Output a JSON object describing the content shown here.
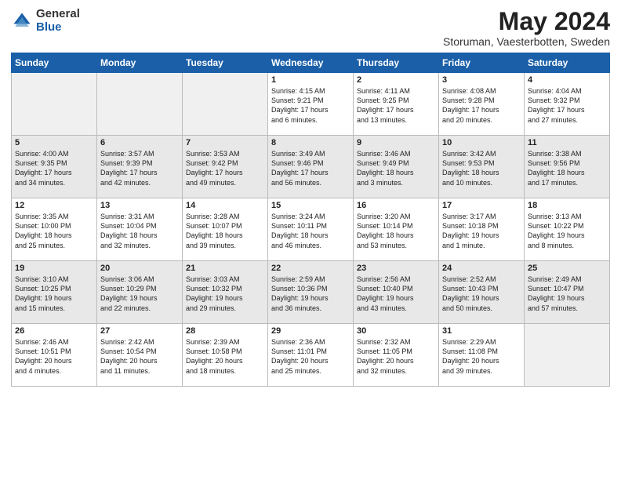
{
  "header": {
    "logo_general": "General",
    "logo_blue": "Blue",
    "title": "May 2024",
    "location": "Storuman, Vaesterbotten, Sweden"
  },
  "weekdays": [
    "Sunday",
    "Monday",
    "Tuesday",
    "Wednesday",
    "Thursday",
    "Friday",
    "Saturday"
  ],
  "weeks": [
    [
      {
        "day": "",
        "info": ""
      },
      {
        "day": "",
        "info": ""
      },
      {
        "day": "",
        "info": ""
      },
      {
        "day": "1",
        "info": "Sunrise: 4:15 AM\nSunset: 9:21 PM\nDaylight: 17 hours\nand 6 minutes."
      },
      {
        "day": "2",
        "info": "Sunrise: 4:11 AM\nSunset: 9:25 PM\nDaylight: 17 hours\nand 13 minutes."
      },
      {
        "day": "3",
        "info": "Sunrise: 4:08 AM\nSunset: 9:28 PM\nDaylight: 17 hours\nand 20 minutes."
      },
      {
        "day": "4",
        "info": "Sunrise: 4:04 AM\nSunset: 9:32 PM\nDaylight: 17 hours\nand 27 minutes."
      }
    ],
    [
      {
        "day": "5",
        "info": "Sunrise: 4:00 AM\nSunset: 9:35 PM\nDaylight: 17 hours\nand 34 minutes."
      },
      {
        "day": "6",
        "info": "Sunrise: 3:57 AM\nSunset: 9:39 PM\nDaylight: 17 hours\nand 42 minutes."
      },
      {
        "day": "7",
        "info": "Sunrise: 3:53 AM\nSunset: 9:42 PM\nDaylight: 17 hours\nand 49 minutes."
      },
      {
        "day": "8",
        "info": "Sunrise: 3:49 AM\nSunset: 9:46 PM\nDaylight: 17 hours\nand 56 minutes."
      },
      {
        "day": "9",
        "info": "Sunrise: 3:46 AM\nSunset: 9:49 PM\nDaylight: 18 hours\nand 3 minutes."
      },
      {
        "day": "10",
        "info": "Sunrise: 3:42 AM\nSunset: 9:53 PM\nDaylight: 18 hours\nand 10 minutes."
      },
      {
        "day": "11",
        "info": "Sunrise: 3:38 AM\nSunset: 9:56 PM\nDaylight: 18 hours\nand 17 minutes."
      }
    ],
    [
      {
        "day": "12",
        "info": "Sunrise: 3:35 AM\nSunset: 10:00 PM\nDaylight: 18 hours\nand 25 minutes."
      },
      {
        "day": "13",
        "info": "Sunrise: 3:31 AM\nSunset: 10:04 PM\nDaylight: 18 hours\nand 32 minutes."
      },
      {
        "day": "14",
        "info": "Sunrise: 3:28 AM\nSunset: 10:07 PM\nDaylight: 18 hours\nand 39 minutes."
      },
      {
        "day": "15",
        "info": "Sunrise: 3:24 AM\nSunset: 10:11 PM\nDaylight: 18 hours\nand 46 minutes."
      },
      {
        "day": "16",
        "info": "Sunrise: 3:20 AM\nSunset: 10:14 PM\nDaylight: 18 hours\nand 53 minutes."
      },
      {
        "day": "17",
        "info": "Sunrise: 3:17 AM\nSunset: 10:18 PM\nDaylight: 19 hours\nand 1 minute."
      },
      {
        "day": "18",
        "info": "Sunrise: 3:13 AM\nSunset: 10:22 PM\nDaylight: 19 hours\nand 8 minutes."
      }
    ],
    [
      {
        "day": "19",
        "info": "Sunrise: 3:10 AM\nSunset: 10:25 PM\nDaylight: 19 hours\nand 15 minutes."
      },
      {
        "day": "20",
        "info": "Sunrise: 3:06 AM\nSunset: 10:29 PM\nDaylight: 19 hours\nand 22 minutes."
      },
      {
        "day": "21",
        "info": "Sunrise: 3:03 AM\nSunset: 10:32 PM\nDaylight: 19 hours\nand 29 minutes."
      },
      {
        "day": "22",
        "info": "Sunrise: 2:59 AM\nSunset: 10:36 PM\nDaylight: 19 hours\nand 36 minutes."
      },
      {
        "day": "23",
        "info": "Sunrise: 2:56 AM\nSunset: 10:40 PM\nDaylight: 19 hours\nand 43 minutes."
      },
      {
        "day": "24",
        "info": "Sunrise: 2:52 AM\nSunset: 10:43 PM\nDaylight: 19 hours\nand 50 minutes."
      },
      {
        "day": "25",
        "info": "Sunrise: 2:49 AM\nSunset: 10:47 PM\nDaylight: 19 hours\nand 57 minutes."
      }
    ],
    [
      {
        "day": "26",
        "info": "Sunrise: 2:46 AM\nSunset: 10:51 PM\nDaylight: 20 hours\nand 4 minutes."
      },
      {
        "day": "27",
        "info": "Sunrise: 2:42 AM\nSunset: 10:54 PM\nDaylight: 20 hours\nand 11 minutes."
      },
      {
        "day": "28",
        "info": "Sunrise: 2:39 AM\nSunset: 10:58 PM\nDaylight: 20 hours\nand 18 minutes."
      },
      {
        "day": "29",
        "info": "Sunrise: 2:36 AM\nSunset: 11:01 PM\nDaylight: 20 hours\nand 25 minutes."
      },
      {
        "day": "30",
        "info": "Sunrise: 2:32 AM\nSunset: 11:05 PM\nDaylight: 20 hours\nand 32 minutes."
      },
      {
        "day": "31",
        "info": "Sunrise: 2:29 AM\nSunset: 11:08 PM\nDaylight: 20 hours\nand 39 minutes."
      },
      {
        "day": "",
        "info": ""
      }
    ]
  ]
}
